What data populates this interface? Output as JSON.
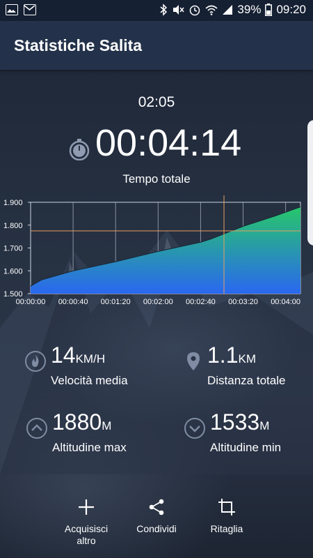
{
  "status_bar": {
    "battery": "39%",
    "time": "09:20",
    "icons": [
      "image-icon",
      "mail-icon",
      "bluetooth-icon",
      "mute-icon",
      "alarm-icon",
      "wifi-icon",
      "signal-icon",
      "battery-icon"
    ]
  },
  "app_bar": {
    "title": "Statistiche Salita"
  },
  "session": {
    "clock": "02:05",
    "timer": "00:04:14",
    "timer_label": "Tempo totale"
  },
  "chart_data": {
    "type": "area",
    "y_ticks": [
      "1.900",
      "1.800",
      "1.700",
      "1.600",
      "1.500"
    ],
    "x_ticks": [
      "00:00:00",
      "00:00:40",
      "00:01:20",
      "00:02:00",
      "00:02:40",
      "00:03:20",
      "00:04:00"
    ],
    "ylim": [
      1500,
      1900
    ],
    "xlim_seconds": [
      0,
      254
    ],
    "x": [
      0,
      10,
      40,
      80,
      120,
      160,
      170,
      200,
      230,
      248,
      254
    ],
    "y": [
      1533,
      1560,
      1600,
      1640,
      1685,
      1725,
      1740,
      1795,
      1840,
      1870,
      1880
    ],
    "crosshair": {
      "x": 182,
      "y": 1775
    },
    "grid": true,
    "colors": {
      "top": "#27c76a",
      "bottom": "#2a67f0",
      "crosshair": "#e8a060"
    }
  },
  "stats": {
    "speed": {
      "value": "14",
      "unit": "KM/H",
      "label": "Velocità media",
      "icon": "flame-icon"
    },
    "distance": {
      "value": "1.1",
      "unit": "KM",
      "label": "Distanza totale",
      "icon": "location-pin-icon"
    },
    "alt_max": {
      "value": "1880",
      "unit": "M",
      "label": "Altitudine max",
      "icon": "chevron-up-circle-icon"
    },
    "alt_min": {
      "value": "1533",
      "unit": "M",
      "label": "Altitudine min",
      "icon": "chevron-down-circle-icon"
    }
  },
  "actions": {
    "acquire": {
      "label": "Acquisisci altro",
      "icon": "plus-icon"
    },
    "share": {
      "label": "Condividi",
      "icon": "share-icon"
    },
    "crop": {
      "label": "Ritaglia",
      "icon": "crop-icon"
    }
  }
}
